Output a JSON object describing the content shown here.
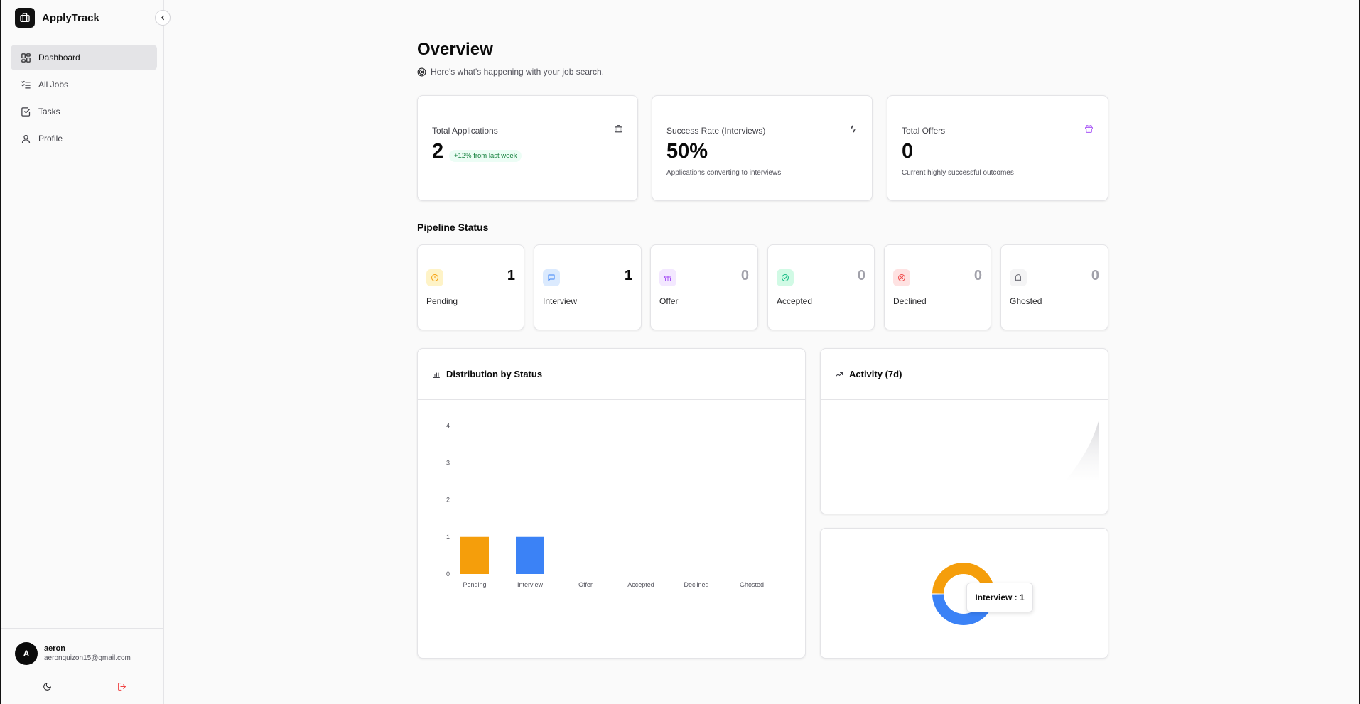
{
  "app": {
    "name": "ApplyTrack"
  },
  "sidebar": {
    "items": [
      {
        "label": "Dashboard",
        "icon": "dashboard-icon",
        "active": true
      },
      {
        "label": "All Jobs",
        "icon": "list-checks-icon",
        "active": false
      },
      {
        "label": "Tasks",
        "icon": "check-square-icon",
        "active": false
      },
      {
        "label": "Profile",
        "icon": "user-icon",
        "active": false
      }
    ],
    "user": {
      "initial": "A",
      "name": "aeron",
      "email": "aeronquizon15@gmail.com"
    }
  },
  "header": {
    "title": "Overview",
    "subtitle": "Here's what's happening with your job search."
  },
  "stats": [
    {
      "label": "Total Applications",
      "value": "2",
      "badge": "+12% from last week",
      "icon": "briefcase-icon"
    },
    {
      "label": "Success Rate (Interviews)",
      "value": "50%",
      "sub": "Applications converting to interviews",
      "icon": "activity-icon"
    },
    {
      "label": "Total Offers",
      "value": "0",
      "sub": "Current highly successful outcomes",
      "icon": "gift-icon"
    }
  ],
  "pipeline": {
    "title": "Pipeline Status",
    "items": [
      {
        "label": "Pending",
        "count": "1",
        "icon": "clock-icon",
        "color": "#f59e0b",
        "bg": "#fef3c7"
      },
      {
        "label": "Interview",
        "count": "1",
        "icon": "message-icon",
        "color": "#3b82f6",
        "bg": "#dbeafe"
      },
      {
        "label": "Offer",
        "count": "0",
        "icon": "gift-icon",
        "color": "#a855f7",
        "bg": "#f3e8ff"
      },
      {
        "label": "Accepted",
        "count": "0",
        "icon": "check-circle-icon",
        "color": "#10b981",
        "bg": "#d1fae5"
      },
      {
        "label": "Declined",
        "count": "0",
        "icon": "x-circle-icon",
        "color": "#ef4444",
        "bg": "#fee2e2"
      },
      {
        "label": "Ghosted",
        "count": "0",
        "icon": "ghost-icon",
        "color": "#71717a",
        "bg": "#f4f4f5"
      }
    ]
  },
  "charts": {
    "distribution_title": "Distribution by Status",
    "activity_title": "Activity (7d)",
    "tooltip": "Interview : 1"
  },
  "chart_data": [
    {
      "type": "bar",
      "title": "Distribution by Status",
      "categories": [
        "Pending",
        "Interview",
        "Offer",
        "Accepted",
        "Declined",
        "Ghosted"
      ],
      "values": [
        1,
        1,
        0,
        0,
        0,
        0
      ],
      "colors": [
        "#f59e0b",
        "#3b82f6",
        "#a855f7",
        "#10b981",
        "#ef4444",
        "#71717a"
      ],
      "yticks": [
        "0",
        "1",
        "2",
        "3",
        "4"
      ],
      "ylim": [
        0,
        4
      ],
      "grid": false
    },
    {
      "type": "pie",
      "categories": [
        "Pending",
        "Interview"
      ],
      "values": [
        1,
        1
      ],
      "colors": [
        "#f59e0b",
        "#3b82f6"
      ]
    }
  ]
}
